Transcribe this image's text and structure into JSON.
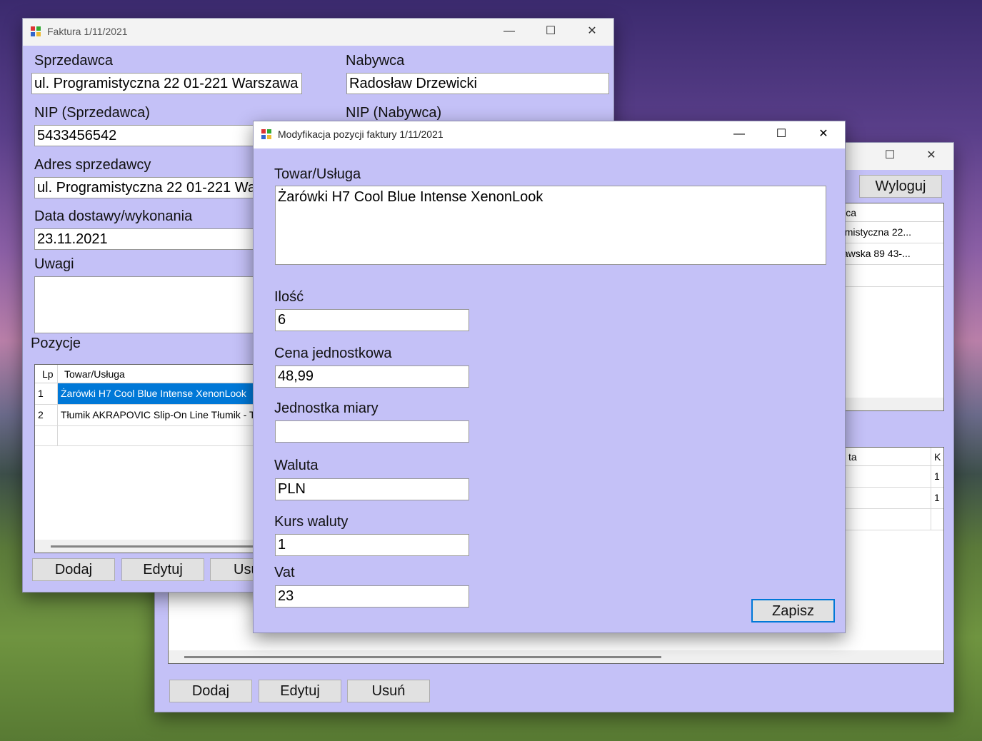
{
  "invoice_window": {
    "title": "Faktura 1/11/2021",
    "seller_label": "Sprzedawca",
    "seller_value": "ul. Programistyczna 22 01-221 Warszawa",
    "buyer_label": "Nabywca",
    "buyer_value": "Radosław Drzewicki",
    "seller_nip_label": "NIP (Sprzedawca)",
    "seller_nip_value": "5433456542",
    "buyer_nip_label": "NIP (Nabywca)",
    "seller_address_label": "Adres sprzedawcy",
    "seller_address_value": "ul. Programistyczna 22 01-221 Warszawa",
    "delivery_date_label": "Data dostawy/wykonania",
    "delivery_date_value": "23.11.2021",
    "notes_label": "Uwagi",
    "notes_value": "",
    "positions_label": "Pozycje",
    "positions_table": {
      "headers": [
        "Lp",
        "Towar/Usługa"
      ],
      "rows": [
        [
          "1",
          "Żarówki H7 Cool Blue Intense XenonLook"
        ],
        [
          "2",
          "Tłumik AKRAPOVIC Slip-On Line Tłumik - Tytan"
        ]
      ]
    },
    "buttons": {
      "add": "Dodaj",
      "edit": "Edytuj",
      "delete": "Usuń"
    }
  },
  "main_window": {
    "logout_label": "Wyloguj",
    "top_table": {
      "header_seller": "Sprzedawca",
      "rows": [
        "ul. Programistyczna 22...",
        "ul. Warszawska 89 43-..."
      ]
    },
    "bottom_table": {
      "header_partial_a": "ta",
      "header_partial_b": "K",
      "rows": [
        "1",
        "1"
      ]
    },
    "buttons": {
      "add": "Dodaj",
      "edit": "Edytuj",
      "delete": "Usuń"
    }
  },
  "dialog": {
    "title": "Modyfikacja pozycji faktury 1/11/2021",
    "item_label": "Towar/Usługa",
    "item_value": "Żarówki H7 Cool Blue Intense XenonLook",
    "qty_label": "Ilość",
    "qty_value": "6",
    "price_label": "Cena jednostkowa",
    "price_value": "48,99",
    "unit_label": "Jednostka miary",
    "unit_value": "",
    "currency_label": "Waluta",
    "currency_value": "PLN",
    "rate_label": "Kurs waluty",
    "rate_value": "1",
    "vat_label": "Vat",
    "vat_value": "23",
    "save_label": "Zapisz"
  },
  "window_controls": {
    "minimize": "—",
    "maximize": "☐",
    "close": "✕"
  },
  "colors": {
    "form_bg": "#c4c1f7",
    "selection": "#0078d7",
    "titlebar": "#f3f3f3"
  }
}
